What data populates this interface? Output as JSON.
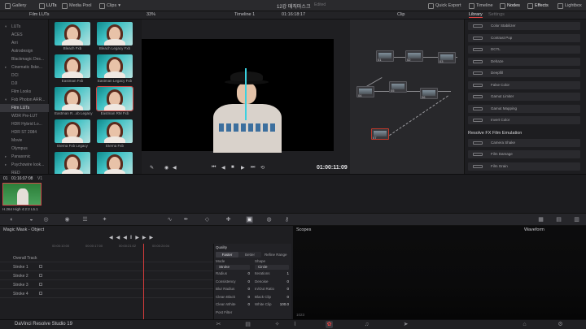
{
  "topbar": {
    "gallery": "Gallery",
    "luts": "LUTs",
    "media_pool": "Media Pool",
    "clips": "Clips",
    "project_title": "12강 매직마스크",
    "project_status": "Edited",
    "quick_export": "Quick Export",
    "timeline": "Timeline",
    "nodes": "Nodes",
    "effects": "Effects",
    "lightbox": "Lightbox"
  },
  "subbar": {
    "panel_title": "Film LUTs",
    "zoom": "33%",
    "timeline_name": "Timeline 1",
    "timecode": "01:16:18:17",
    "node_mode": "Clip",
    "library_tab": "Library",
    "settings_tab": "Settings"
  },
  "media_tree": [
    {
      "label": "LUTs",
      "arrow": "▾",
      "sel": false
    },
    {
      "label": "ACES",
      "arrow": "",
      "sel": false
    },
    {
      "label": "Arri",
      "arrow": "",
      "sel": false
    },
    {
      "label": "Astrodesign",
      "arrow": "",
      "sel": false
    },
    {
      "label": "Blackmagic Des...",
      "arrow": "",
      "sel": false
    },
    {
      "label": "Cinematic Ilske...",
      "arrow": "▸",
      "sel": false
    },
    {
      "label": "DCI",
      "arrow": "",
      "sel": false
    },
    {
      "label": "DJI",
      "arrow": "",
      "sel": false
    },
    {
      "label": "Film Looks",
      "arrow": "",
      "sel": false
    },
    {
      "label": "Fxb Photon ARR...",
      "arrow": "▾",
      "sel": false
    },
    {
      "label": "Film LUTs",
      "arrow": "",
      "sel": true
    },
    {
      "label": "WDR Pre-LUT",
      "arrow": "",
      "sel": false
    },
    {
      "label": "HDR Hybrid Lo...",
      "arrow": "",
      "sel": false
    },
    {
      "label": "HDR ST 2084",
      "arrow": "",
      "sel": false
    },
    {
      "label": "Movie",
      "arrow": "",
      "sel": false
    },
    {
      "label": "Olympus",
      "arrow": "",
      "sel": false
    },
    {
      "label": "Panasonic",
      "arrow": "▸",
      "sel": false
    },
    {
      "label": "Psychowire look...",
      "arrow": "▸",
      "sel": false
    },
    {
      "label": "RED",
      "arrow": "",
      "sel": false
    }
  ],
  "luts": [
    {
      "label": "Bleach Fxb",
      "sel": false
    },
    {
      "label": "Bleach Legacy Fxb",
      "sel": false
    },
    {
      "label": "Eastman Fxb",
      "sel": false
    },
    {
      "label": "Eastman Legacy Fxb",
      "sel": false
    },
    {
      "label": "Eastman R...xb Legacy",
      "sel": false
    },
    {
      "label": "Eastman RM Fxb",
      "sel": true
    },
    {
      "label": "Eterna Fxb Legacy",
      "sel": false
    },
    {
      "label": "Eterna Fxb",
      "sel": false
    },
    {
      "label": "Vision Fxb Legacy",
      "sel": false
    },
    {
      "label": "Vision Fxb",
      "sel": false
    }
  ],
  "viewer": {
    "timecode": "01:00:11:09"
  },
  "nodes": [
    {
      "label": "01"
    },
    {
      "label": "02"
    },
    {
      "label": "03"
    },
    {
      "label": "04"
    },
    {
      "label": "05"
    },
    {
      "label": "06"
    },
    {
      "label": "07"
    }
  ],
  "library": {
    "items_a": [
      "Color Stabilizer",
      "Contrast Pop",
      "DCTL",
      "Dehaze",
      "Deepfill",
      "False Color",
      "Gamut Limiter",
      "Gamut Mapping",
      "Invert Color"
    ],
    "section_b": "Resolve FX Film Emulation",
    "items_b": [
      "Camera Shake",
      "Film Damage",
      "Film Grain"
    ]
  },
  "clip": {
    "number": "01",
    "timecode": "01:16:07:08",
    "track": "V1",
    "codec": "H.264 High 4:2:2 L5.1"
  },
  "mask": {
    "title": "Magic Mask - Object",
    "ruler": [
      "00:00:10:00",
      "00:00:17:00",
      "00:00:21:02",
      "00:00:24:04"
    ],
    "tracks": [
      "Overall Track",
      "Stroke 1",
      "Stroke 2",
      "Stroke 3",
      "Stroke 4"
    ]
  },
  "quality": {
    "title": "Quality",
    "faster": "Faster",
    "better": "Better",
    "refine_range": "Refine Range",
    "mode_label": "Mode",
    "mode_value": "Stroke",
    "shape_label": "Shape",
    "shape_value": "Circle",
    "params": [
      {
        "label": "Radius",
        "value": "0"
      },
      {
        "label": "Consistency",
        "value": "0"
      },
      {
        "label": "Blur Radius",
        "value": "0"
      },
      {
        "label": "Clean Black",
        "value": "0"
      },
      {
        "label": "Clean White",
        "value": "0"
      },
      {
        "label": "Post Filter",
        "value": ""
      }
    ],
    "params_right": [
      {
        "label": "Iterations",
        "value": "1"
      },
      {
        "label": "Denoise",
        "value": "0"
      },
      {
        "label": "In/Out Ratio",
        "value": "0"
      },
      {
        "label": "Black Clip",
        "value": "0"
      },
      {
        "label": "White Clip",
        "value": "100.0"
      }
    ]
  },
  "scopes": {
    "title": "Scopes",
    "mode": "Waveform",
    "value": "1023"
  },
  "bottom": {
    "app_name": "DaVinci Resolve Studio 19"
  }
}
